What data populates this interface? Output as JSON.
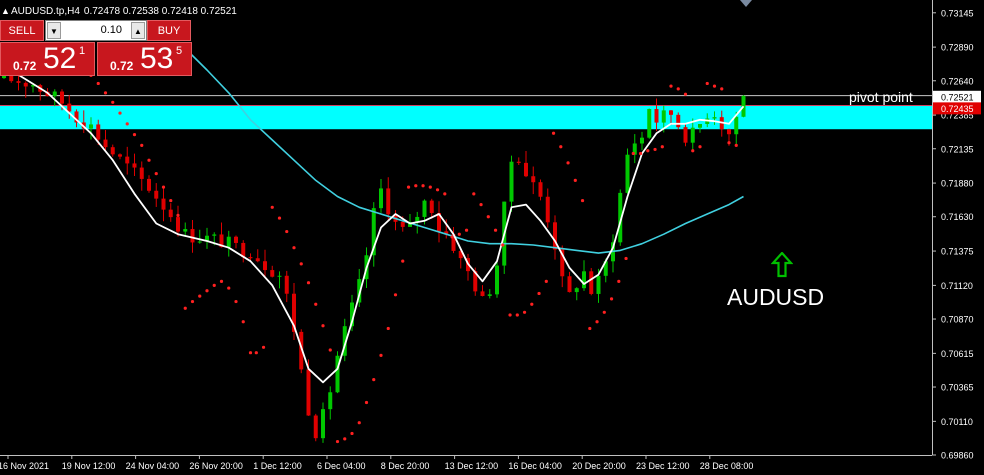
{
  "header": {
    "caret_icon": "dropdown-caret-icon",
    "symbol": "AUDUSD.tp,H4",
    "ohlc": "0.72478 0.72538 0.72418 0.72521"
  },
  "trade_panel": {
    "sell_label": "SELL",
    "buy_label": "BUY",
    "lot_value": "0.10",
    "sell_price": {
      "prefix": "0.72",
      "big": "52",
      "sup": "1"
    },
    "buy_price": {
      "prefix": "0.72",
      "big": "53",
      "sup": "5"
    }
  },
  "annotations": {
    "pivot_label": "pivot point",
    "symbol_label": "AUDUSD",
    "arrow_icon": "up-arrow-outline-icon",
    "arrow_color": "#00c000"
  },
  "colors": {
    "background": "#000000",
    "bull": "#00c800",
    "bear": "#e00000",
    "ma_fast": "#ffffff",
    "ma_slow": "#40d0e0",
    "sar": "#ff2020",
    "zone": "#00ffff",
    "current_price_tag": "#ffffff",
    "zone_price_tag": "#e00000"
  },
  "chart_data": {
    "type": "candlestick",
    "ylim": [
      0.6986,
      0.7324
    ],
    "price_axis_labels": [
      "0.73145",
      "0.72890",
      "0.72640",
      "0.72385",
      "0.72135",
      "0.71880",
      "0.71630",
      "0.71375",
      "0.71120",
      "0.70870",
      "0.70615",
      "0.70365",
      "0.70110",
      "0.69860"
    ],
    "time_axis_labels": [
      "16 Nov 2021",
      "19 Nov 12:00",
      "24 Nov 04:00",
      "26 Nov 20:00",
      "1 Dec 12:00",
      "6 Dec 04:00",
      "8 Dec 20:00",
      "13 Dec 12:00",
      "16 Dec 04:00",
      "20 Dec 20:00",
      "23 Dec 12:00",
      "28 Dec 08:00"
    ],
    "current_price_tag": "0.72521",
    "zone_price_tag": "0.72435",
    "pivot_zone": [
      0.7228,
      0.7246
    ],
    "pivot_line": 0.7253,
    "path_close": [
      [
        0,
        0.7266
      ],
      [
        4,
        0.7262
      ],
      [
        6,
        0.7255
      ],
      [
        8,
        0.7248
      ],
      [
        10,
        0.7238
      ],
      [
        12,
        0.723
      ],
      [
        14,
        0.7216
      ],
      [
        17,
        0.72
      ],
      [
        20,
        0.7185
      ],
      [
        23,
        0.7165
      ],
      [
        25,
        0.715
      ],
      [
        28,
        0.7147
      ],
      [
        30,
        0.7145
      ],
      [
        32,
        0.714
      ],
      [
        34,
        0.7138
      ],
      [
        36,
        0.7128
      ],
      [
        38,
        0.712
      ],
      [
        39.5,
        0.7095
      ],
      [
        40.5,
        0.7065
      ],
      [
        41.5,
        0.7032
      ],
      [
        42.5,
        0.701
      ],
      [
        43.2,
        0.7002
      ],
      [
        44.5,
        0.7022
      ],
      [
        46,
        0.706
      ],
      [
        48,
        0.7095
      ],
      [
        49.5,
        0.712
      ],
      [
        51,
        0.7165
      ],
      [
        52,
        0.7183
      ],
      [
        54,
        0.7158
      ],
      [
        55.5,
        0.715
      ],
      [
        57,
        0.7165
      ],
      [
        58.5,
        0.7178
      ],
      [
        60,
        0.7155
      ],
      [
        61.5,
        0.7148
      ],
      [
        63,
        0.713
      ],
      [
        64.5,
        0.7118
      ],
      [
        66,
        0.71
      ],
      [
        67.5,
        0.7115
      ],
      [
        68.5,
        0.7142
      ],
      [
        69.5,
        0.7195
      ],
      [
        70.5,
        0.7215
      ],
      [
        72,
        0.7195
      ],
      [
        74,
        0.7178
      ],
      [
        75.5,
        0.7155
      ],
      [
        76.5,
        0.713
      ],
      [
        77.5,
        0.7098
      ],
      [
        78.5,
        0.711
      ],
      [
        80,
        0.7122
      ],
      [
        81,
        0.7108
      ],
      [
        82.5,
        0.7118
      ],
      [
        83.5,
        0.7138
      ],
      [
        84.5,
        0.716
      ],
      [
        85.5,
        0.72
      ],
      [
        86.5,
        0.7218
      ],
      [
        88,
        0.7222
      ],
      [
        89,
        0.7245
      ],
      [
        90,
        0.7235
      ],
      [
        92,
        0.724
      ],
      [
        93.5,
        0.7228
      ],
      [
        94.5,
        0.722
      ],
      [
        96,
        0.7232
      ],
      [
        97.5,
        0.7245
      ],
      [
        99,
        0.7232
      ],
      [
        100,
        0.7225
      ],
      [
        101,
        0.7238
      ],
      [
        102,
        0.7252
      ]
    ],
    "ma_fast": [
      [
        0,
        0.7275
      ],
      [
        3,
        0.7265
      ],
      [
        6,
        0.7255
      ],
      [
        9,
        0.724
      ],
      [
        12,
        0.7225
      ],
      [
        15,
        0.7205
      ],
      [
        18,
        0.718
      ],
      [
        21,
        0.7158
      ],
      [
        24,
        0.715
      ],
      [
        28,
        0.7145
      ],
      [
        31,
        0.714
      ],
      [
        34,
        0.713
      ],
      [
        37,
        0.7112
      ],
      [
        40,
        0.7082
      ],
      [
        42,
        0.705
      ],
      [
        44,
        0.704
      ],
      [
        46,
        0.705
      ],
      [
        48,
        0.7085
      ],
      [
        50,
        0.7125
      ],
      [
        52,
        0.7155
      ],
      [
        54,
        0.7165
      ],
      [
        56,
        0.7158
      ],
      [
        58,
        0.716
      ],
      [
        60,
        0.7165
      ],
      [
        62,
        0.715
      ],
      [
        64,
        0.7128
      ],
      [
        66,
        0.7115
      ],
      [
        68,
        0.713
      ],
      [
        70,
        0.717
      ],
      [
        72,
        0.7172
      ],
      [
        74,
        0.716
      ],
      [
        76,
        0.7145
      ],
      [
        78,
        0.7125
      ],
      [
        80,
        0.7113
      ],
      [
        82,
        0.712
      ],
      [
        84,
        0.714
      ],
      [
        86,
        0.7178
      ],
      [
        88,
        0.721
      ],
      [
        90,
        0.7225
      ],
      [
        92,
        0.7232
      ],
      [
        94,
        0.7232
      ],
      [
        96,
        0.7235
      ],
      [
        98,
        0.7234
      ],
      [
        100,
        0.7232
      ],
      [
        102,
        0.7245
      ]
    ],
    "ma_slow": [
      [
        25,
        0.7288
      ],
      [
        28,
        0.7272
      ],
      [
        31,
        0.7255
      ],
      [
        34,
        0.7235
      ],
      [
        37,
        0.722
      ],
      [
        40,
        0.7205
      ],
      [
        43,
        0.719
      ],
      [
        46,
        0.7178
      ],
      [
        49,
        0.717
      ],
      [
        52,
        0.7165
      ],
      [
        55,
        0.716
      ],
      [
        58,
        0.7155
      ],
      [
        61,
        0.715
      ],
      [
        64,
        0.7145
      ],
      [
        67,
        0.7143
      ],
      [
        70,
        0.7143
      ],
      [
        73,
        0.7142
      ],
      [
        76,
        0.714
      ],
      [
        79,
        0.7138
      ],
      [
        82,
        0.7136
      ],
      [
        85,
        0.7138
      ],
      [
        88,
        0.7143
      ],
      [
        91,
        0.715
      ],
      [
        94,
        0.7158
      ],
      [
        97,
        0.7165
      ],
      [
        100,
        0.7172
      ],
      [
        102,
        0.7178
      ]
    ],
    "sar": [
      [
        12,
        0.7268
      ],
      [
        13,
        0.7262
      ],
      [
        14,
        0.7255
      ],
      [
        15,
        0.7248
      ],
      [
        16,
        0.724
      ],
      [
        17,
        0.7232
      ],
      [
        18,
        0.7224
      ],
      [
        19,
        0.7216
      ],
      [
        20,
        0.7205
      ],
      [
        21,
        0.7195
      ],
      [
        22,
        0.7185
      ],
      [
        23,
        0.7175
      ],
      [
        24,
        0.7164
      ],
      [
        25,
        0.7095
      ],
      [
        26,
        0.71
      ],
      [
        27,
        0.7104
      ],
      [
        28,
        0.7108
      ],
      [
        29,
        0.7112
      ],
      [
        30,
        0.7115
      ],
      [
        31,
        0.711
      ],
      [
        32,
        0.71
      ],
      [
        33,
        0.7085
      ],
      [
        34,
        0.7062
      ],
      [
        34.8,
        0.7062
      ],
      [
        35.8,
        0.7066
      ],
      [
        37,
        0.717
      ],
      [
        38,
        0.7162
      ],
      [
        39,
        0.7152
      ],
      [
        40,
        0.714
      ],
      [
        41,
        0.7128
      ],
      [
        42,
        0.7114
      ],
      [
        43,
        0.7098
      ],
      [
        44,
        0.7082
      ],
      [
        45,
        0.7064
      ],
      [
        46,
        0.6996
      ],
      [
        47,
        0.6998
      ],
      [
        48,
        0.7002
      ],
      [
        49,
        0.701
      ],
      [
        50,
        0.7025
      ],
      [
        51,
        0.7042
      ],
      [
        52,
        0.706
      ],
      [
        53,
        0.708
      ],
      [
        54,
        0.7105
      ],
      [
        55,
        0.713
      ],
      [
        55.8,
        0.7185
      ],
      [
        56.8,
        0.7186
      ],
      [
        57.8,
        0.7186
      ],
      [
        58.8,
        0.7185
      ],
      [
        59.8,
        0.7183
      ],
      [
        60.8,
        0.718
      ],
      [
        61.8,
        0.7148
      ],
      [
        62.8,
        0.715
      ],
      [
        63.8,
        0.7153
      ],
      [
        64.8,
        0.718
      ],
      [
        65.8,
        0.7172
      ],
      [
        66.8,
        0.7163
      ],
      [
        67.8,
        0.7153
      ],
      [
        68.8,
        0.7142
      ],
      [
        69.8,
        0.709
      ],
      [
        70.8,
        0.709
      ],
      [
        71.8,
        0.7092
      ],
      [
        72.8,
        0.7098
      ],
      [
        73.8,
        0.7106
      ],
      [
        74.8,
        0.7115
      ],
      [
        75.8,
        0.7225
      ],
      [
        76.8,
        0.7215
      ],
      [
        77.8,
        0.7203
      ],
      [
        78.8,
        0.719
      ],
      [
        79.8,
        0.7175
      ],
      [
        80.8,
        0.708
      ],
      [
        81.8,
        0.7085
      ],
      [
        82.8,
        0.7092
      ],
      [
        83.8,
        0.7102
      ],
      [
        84.8,
        0.7115
      ],
      [
        85.8,
        0.7132
      ],
      [
        86.8,
        0.721
      ],
      [
        87.8,
        0.721
      ],
      [
        88.8,
        0.7212
      ],
      [
        89.8,
        0.7213
      ],
      [
        90.8,
        0.7215
      ],
      [
        92,
        0.726
      ],
      [
        93,
        0.7258
      ],
      [
        94,
        0.7254
      ],
      [
        95,
        0.7212
      ],
      [
        96,
        0.7215
      ],
      [
        97,
        0.7262
      ],
      [
        98,
        0.726
      ],
      [
        99,
        0.7258
      ],
      [
        100,
        0.7218
      ],
      [
        101,
        0.7216
      ]
    ]
  }
}
